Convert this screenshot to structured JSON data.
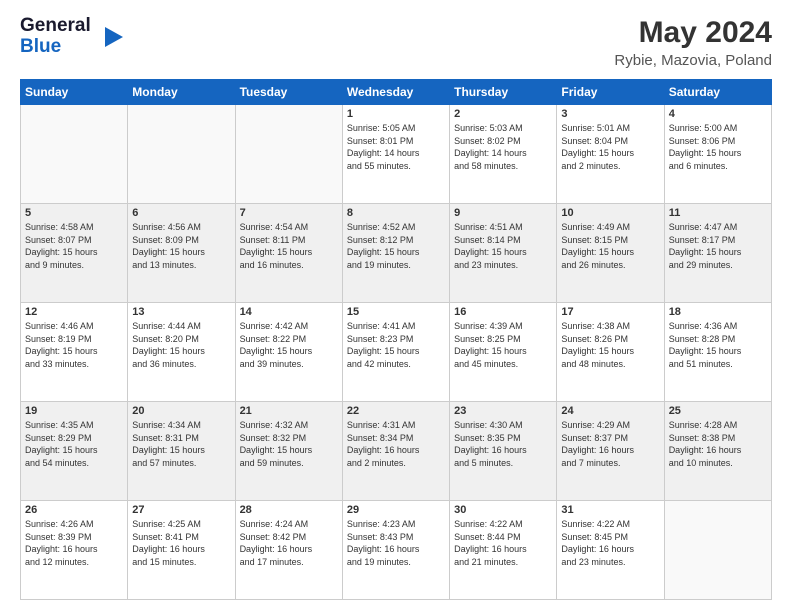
{
  "header": {
    "logo_line1": "General",
    "logo_line2": "Blue",
    "title": "May 2024",
    "subtitle": "Rybie, Mazovia, Poland"
  },
  "days_of_week": [
    "Sunday",
    "Monday",
    "Tuesday",
    "Wednesday",
    "Thursday",
    "Friday",
    "Saturday"
  ],
  "weeks": [
    [
      {
        "day": "",
        "info": ""
      },
      {
        "day": "",
        "info": ""
      },
      {
        "day": "",
        "info": ""
      },
      {
        "day": "1",
        "info": "Sunrise: 5:05 AM\nSunset: 8:01 PM\nDaylight: 14 hours\nand 55 minutes."
      },
      {
        "day": "2",
        "info": "Sunrise: 5:03 AM\nSunset: 8:02 PM\nDaylight: 14 hours\nand 58 minutes."
      },
      {
        "day": "3",
        "info": "Sunrise: 5:01 AM\nSunset: 8:04 PM\nDaylight: 15 hours\nand 2 minutes."
      },
      {
        "day": "4",
        "info": "Sunrise: 5:00 AM\nSunset: 8:06 PM\nDaylight: 15 hours\nand 6 minutes."
      }
    ],
    [
      {
        "day": "5",
        "info": "Sunrise: 4:58 AM\nSunset: 8:07 PM\nDaylight: 15 hours\nand 9 minutes."
      },
      {
        "day": "6",
        "info": "Sunrise: 4:56 AM\nSunset: 8:09 PM\nDaylight: 15 hours\nand 13 minutes."
      },
      {
        "day": "7",
        "info": "Sunrise: 4:54 AM\nSunset: 8:11 PM\nDaylight: 15 hours\nand 16 minutes."
      },
      {
        "day": "8",
        "info": "Sunrise: 4:52 AM\nSunset: 8:12 PM\nDaylight: 15 hours\nand 19 minutes."
      },
      {
        "day": "9",
        "info": "Sunrise: 4:51 AM\nSunset: 8:14 PM\nDaylight: 15 hours\nand 23 minutes."
      },
      {
        "day": "10",
        "info": "Sunrise: 4:49 AM\nSunset: 8:15 PM\nDaylight: 15 hours\nand 26 minutes."
      },
      {
        "day": "11",
        "info": "Sunrise: 4:47 AM\nSunset: 8:17 PM\nDaylight: 15 hours\nand 29 minutes."
      }
    ],
    [
      {
        "day": "12",
        "info": "Sunrise: 4:46 AM\nSunset: 8:19 PM\nDaylight: 15 hours\nand 33 minutes."
      },
      {
        "day": "13",
        "info": "Sunrise: 4:44 AM\nSunset: 8:20 PM\nDaylight: 15 hours\nand 36 minutes."
      },
      {
        "day": "14",
        "info": "Sunrise: 4:42 AM\nSunset: 8:22 PM\nDaylight: 15 hours\nand 39 minutes."
      },
      {
        "day": "15",
        "info": "Sunrise: 4:41 AM\nSunset: 8:23 PM\nDaylight: 15 hours\nand 42 minutes."
      },
      {
        "day": "16",
        "info": "Sunrise: 4:39 AM\nSunset: 8:25 PM\nDaylight: 15 hours\nand 45 minutes."
      },
      {
        "day": "17",
        "info": "Sunrise: 4:38 AM\nSunset: 8:26 PM\nDaylight: 15 hours\nand 48 minutes."
      },
      {
        "day": "18",
        "info": "Sunrise: 4:36 AM\nSunset: 8:28 PM\nDaylight: 15 hours\nand 51 minutes."
      }
    ],
    [
      {
        "day": "19",
        "info": "Sunrise: 4:35 AM\nSunset: 8:29 PM\nDaylight: 15 hours\nand 54 minutes."
      },
      {
        "day": "20",
        "info": "Sunrise: 4:34 AM\nSunset: 8:31 PM\nDaylight: 15 hours\nand 57 minutes."
      },
      {
        "day": "21",
        "info": "Sunrise: 4:32 AM\nSunset: 8:32 PM\nDaylight: 15 hours\nand 59 minutes."
      },
      {
        "day": "22",
        "info": "Sunrise: 4:31 AM\nSunset: 8:34 PM\nDaylight: 16 hours\nand 2 minutes."
      },
      {
        "day": "23",
        "info": "Sunrise: 4:30 AM\nSunset: 8:35 PM\nDaylight: 16 hours\nand 5 minutes."
      },
      {
        "day": "24",
        "info": "Sunrise: 4:29 AM\nSunset: 8:37 PM\nDaylight: 16 hours\nand 7 minutes."
      },
      {
        "day": "25",
        "info": "Sunrise: 4:28 AM\nSunset: 8:38 PM\nDaylight: 16 hours\nand 10 minutes."
      }
    ],
    [
      {
        "day": "26",
        "info": "Sunrise: 4:26 AM\nSunset: 8:39 PM\nDaylight: 16 hours\nand 12 minutes."
      },
      {
        "day": "27",
        "info": "Sunrise: 4:25 AM\nSunset: 8:41 PM\nDaylight: 16 hours\nand 15 minutes."
      },
      {
        "day": "28",
        "info": "Sunrise: 4:24 AM\nSunset: 8:42 PM\nDaylight: 16 hours\nand 17 minutes."
      },
      {
        "day": "29",
        "info": "Sunrise: 4:23 AM\nSunset: 8:43 PM\nDaylight: 16 hours\nand 19 minutes."
      },
      {
        "day": "30",
        "info": "Sunrise: 4:22 AM\nSunset: 8:44 PM\nDaylight: 16 hours\nand 21 minutes."
      },
      {
        "day": "31",
        "info": "Sunrise: 4:22 AM\nSunset: 8:45 PM\nDaylight: 16 hours\nand 23 minutes."
      },
      {
        "day": "",
        "info": ""
      }
    ]
  ]
}
